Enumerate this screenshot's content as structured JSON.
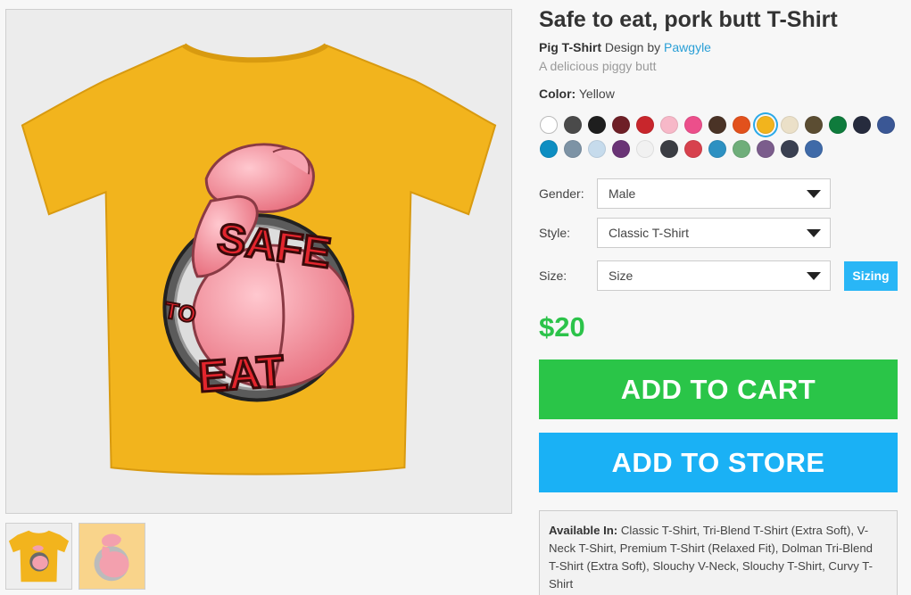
{
  "product": {
    "title": "Safe to eat, pork butt T-Shirt",
    "design_name": "Pig T-Shirt",
    "design_by_text": "Design by",
    "artist": "Pawgyle",
    "subtitle": "A delicious piggy butt",
    "color_label": "Color:",
    "color_value": "Yellow"
  },
  "artwork": {
    "text_safe": "SAFE",
    "text_to": "TO",
    "text_eat": "EAT"
  },
  "swatches": [
    {
      "name": "white",
      "hex": "#ffffff"
    },
    {
      "name": "dark-grey",
      "hex": "#4a4a4a"
    },
    {
      "name": "black",
      "hex": "#1e1e1e"
    },
    {
      "name": "maroon",
      "hex": "#6e1f26"
    },
    {
      "name": "red",
      "hex": "#c8262c"
    },
    {
      "name": "light-pink",
      "hex": "#f7b8c8"
    },
    {
      "name": "hot-pink",
      "hex": "#ec4f8b"
    },
    {
      "name": "brown",
      "hex": "#4a3326"
    },
    {
      "name": "orange",
      "hex": "#e2511c"
    },
    {
      "name": "yellow",
      "hex": "#f2b41d",
      "selected": true
    },
    {
      "name": "natural",
      "hex": "#ebe0c8"
    },
    {
      "name": "olive",
      "hex": "#5b4d32"
    },
    {
      "name": "green",
      "hex": "#0f7b3c"
    },
    {
      "name": "navy",
      "hex": "#262b3d"
    },
    {
      "name": "royal",
      "hex": "#3a5795"
    },
    {
      "name": "sapphire",
      "hex": "#0d8ec2"
    },
    {
      "name": "slate",
      "hex": "#7d93a5"
    },
    {
      "name": "light-blue",
      "hex": "#c6dbec"
    },
    {
      "name": "purple",
      "hex": "#6a3476"
    },
    {
      "name": "heather-white",
      "hex": "#f1f1f1"
    },
    {
      "name": "heather-black",
      "hex": "#3b3d43"
    },
    {
      "name": "heather-red",
      "hex": "#d7414d"
    },
    {
      "name": "heather-blue",
      "hex": "#2d91c2"
    },
    {
      "name": "heather-green",
      "hex": "#6fae7a"
    },
    {
      "name": "heather-purple",
      "hex": "#7b5d8c"
    },
    {
      "name": "heather-navy",
      "hex": "#3a4051"
    },
    {
      "name": "heather-royal",
      "hex": "#3f6aa8"
    }
  ],
  "options": {
    "gender_label": "Gender:",
    "gender_value": "Male",
    "style_label": "Style:",
    "style_value": "Classic T-Shirt",
    "size_label": "Size:",
    "size_value": "Size",
    "sizing_button": "Sizing"
  },
  "price": "$20",
  "buttons": {
    "add_to_cart": "ADD TO CART",
    "add_to_store": "ADD TO STORE"
  },
  "availability": {
    "label": "Available In:",
    "text": "Classic T-Shirt, Tri-Blend T-Shirt (Extra Soft), V-Neck T-Shirt, Premium T-Shirt (Relaxed Fit), Dolman Tri-Blend T-Shirt (Extra Soft), Slouchy V-Neck, Slouchy T-Shirt, Curvy T-Shirt"
  },
  "colors": {
    "shirt": "#f2b41d",
    "price": "#2cc34a",
    "cart_button": "#2ac548",
    "store_button": "#1ab1f5",
    "link": "#2a9fd6"
  }
}
